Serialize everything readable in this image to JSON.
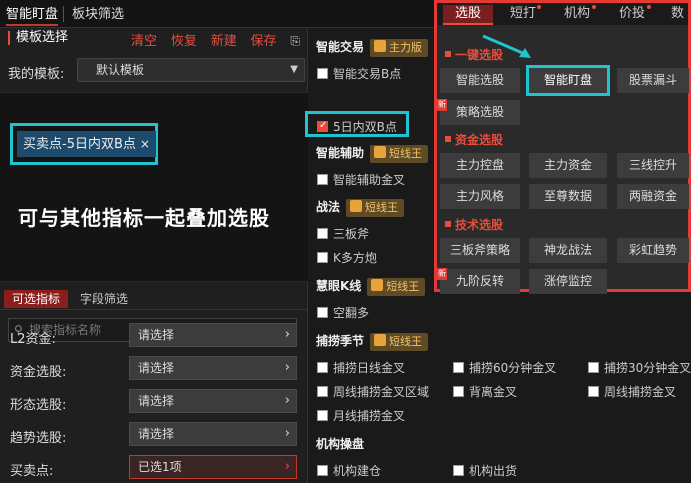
{
  "top_tabs": [
    "智能盯盘",
    "板块筛选"
  ],
  "header": {
    "title": "模板选择",
    "actions": [
      "清空",
      "恢复",
      "新建",
      "保存"
    ],
    "export_icon": "export-icon"
  },
  "template": {
    "label": "我的模板:",
    "value": "默认模板"
  },
  "chip": {
    "label": "买卖点-5日内双B点",
    "close": "×"
  },
  "canvas_text": "可与其他指标一起叠加选股",
  "subtabs": [
    "可选指标",
    "字段筛选"
  ],
  "search_placeholder": "搜索指标名称",
  "filters": [
    {
      "label": "L2资金:",
      "value": "请选择"
    },
    {
      "label": "资金选股:",
      "value": "请选择"
    },
    {
      "label": "形态选股:",
      "value": "请选择"
    },
    {
      "label": "趋势选股:",
      "value": "请选择"
    },
    {
      "label": "买卖点:",
      "value": "已选1项"
    }
  ],
  "mid": {
    "sections": [
      {
        "title": "智能交易",
        "badge": "主力版"
      },
      {
        "title": "智能辅助",
        "badge": "短线王"
      },
      {
        "title": "战法",
        "badge": "短线王"
      },
      {
        "title": "慧眼K线",
        "badge": "短线王"
      },
      {
        "title": "捕捞季节",
        "badge": "短线王"
      },
      {
        "title": "机构操盘",
        "badge": ""
      }
    ],
    "items": {
      "zhjy": [
        "智能交易B点",
        "5日内双B点"
      ],
      "zhfz": [
        "智能辅助金叉"
      ],
      "zf": [
        "三板斧",
        "K多方炮"
      ],
      "hykx": [
        "空翻多"
      ],
      "blj": [
        "捕捞日线金叉",
        "捕捞60分钟金叉",
        "捕捞30分钟金叉",
        "周线捕捞金叉区域",
        "背离金叉",
        "周线捕捞金叉",
        "月线捕捞金叉"
      ],
      "jgcp": [
        "机构建仓",
        "机构出货"
      ]
    }
  },
  "popup": {
    "tabs": [
      "选股",
      "短打",
      "机构",
      "价投",
      "数"
    ],
    "sections": [
      "一键选股",
      "资金选股",
      "技术选股"
    ],
    "yijian": [
      "智能选股",
      "智能盯盘",
      "股票漏斗",
      "策略选股"
    ],
    "zijin": [
      "主力控盘",
      "主力资金",
      "三线控升",
      "主力风格",
      "至尊数据",
      "两融资金"
    ],
    "jishu": [
      "三板斧策略",
      "神龙战法",
      "彩虹趋势",
      "九阶反转",
      "涨停监控"
    ],
    "new_tag": "新"
  },
  "colors": {
    "accent_red": "#e53935",
    "highlight_cyan": "#1fc4cf",
    "badge_gold": "#f2c26b"
  }
}
